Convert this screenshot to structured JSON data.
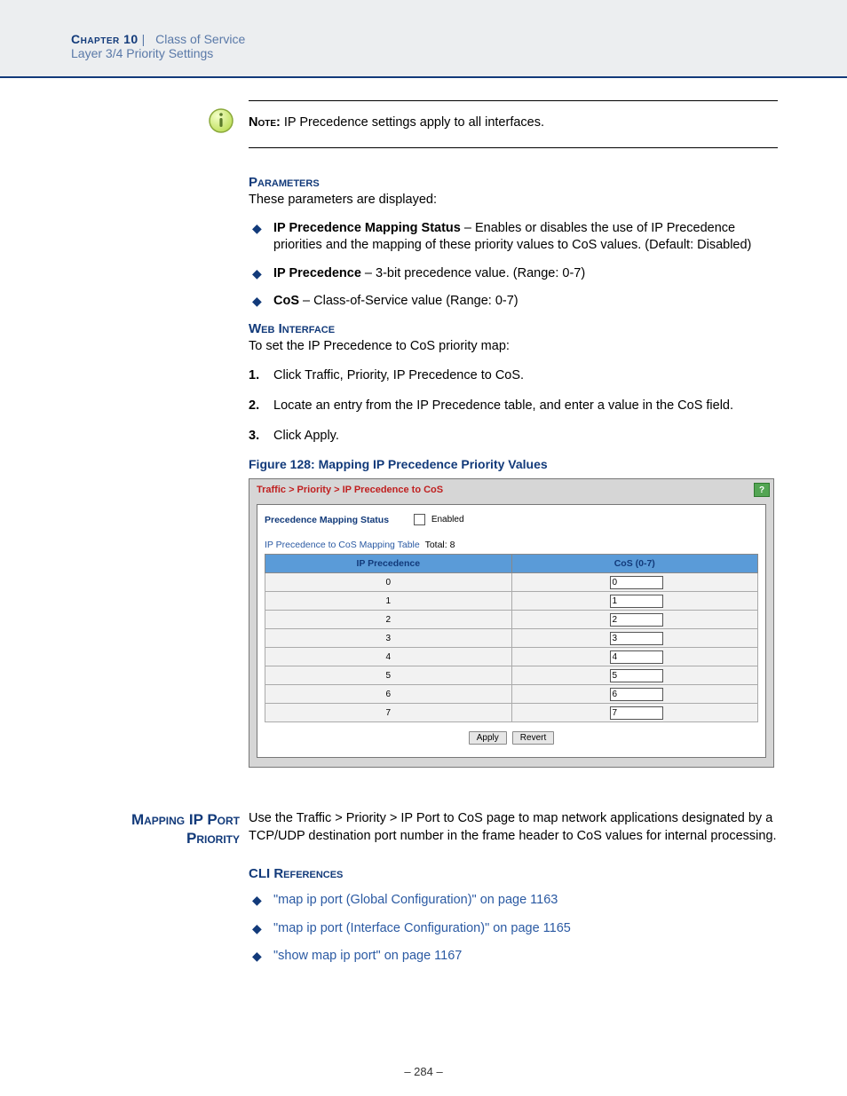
{
  "header": {
    "chapter": "Chapter 10",
    "chapter_title": "Class of Service",
    "subtitle": "Layer 3/4 Priority Settings"
  },
  "note": {
    "label": "Note:",
    "text": " IP Precedence settings apply to all interfaces."
  },
  "parameters": {
    "heading": "Parameters",
    "intro": "These parameters are displayed:",
    "items": [
      {
        "term": "IP Precedence Mapping Status",
        "desc": " – Enables or disables the use of IP Precedence priorities and the mapping of these priority values to CoS values. (Default: Disabled)"
      },
      {
        "term": "IP Precedence",
        "desc": " – 3-bit precedence value. (Range: 0-7)"
      },
      {
        "term": "CoS",
        "desc": " – Class-of-Service value (Range: 0-7)"
      }
    ]
  },
  "webinterface": {
    "heading": "Web Interface",
    "intro": "To set the IP Precedence to CoS priority map:",
    "steps": [
      "Click Traffic, Priority, IP Precedence to CoS.",
      "Locate an entry from the IP Precedence table, and enter a value in the CoS field.",
      "Click Apply."
    ]
  },
  "figure": {
    "caption": "Figure 128:  Mapping IP Precedence Priority Values",
    "breadcrumb": "Traffic > Priority > IP Precedence to CoS",
    "help": "?",
    "mapping_label": "Precedence Mapping Status",
    "enabled_label": "Enabled",
    "table_title_prefix": "IP Precedence to CoS Mapping Table",
    "table_total": "Total: 8",
    "col1": "IP Precedence",
    "col2": "CoS (0-7)",
    "rows": [
      {
        "prec": "0",
        "cos": "0"
      },
      {
        "prec": "1",
        "cos": "1"
      },
      {
        "prec": "2",
        "cos": "2"
      },
      {
        "prec": "3",
        "cos": "3"
      },
      {
        "prec": "4",
        "cos": "4"
      },
      {
        "prec": "5",
        "cos": "5"
      },
      {
        "prec": "6",
        "cos": "6"
      },
      {
        "prec": "7",
        "cos": "7"
      }
    ],
    "apply": "Apply",
    "revert": "Revert"
  },
  "section2": {
    "side_heading_l1": "Mapping IP Port",
    "side_heading_l2": "Priority",
    "intro": "Use the Traffic > Priority > IP Port to CoS page to map network applications designated by a TCP/UDP destination port number in the frame header to CoS values for internal processing.",
    "cli_heading": "CLI References",
    "links": [
      "\"map ip port (Global Configuration)\" on page 1163",
      "\"map ip port (Interface Configuration)\" on page 1165",
      "\"show map ip port\" on page 1167"
    ]
  },
  "page_number": "–  284  –"
}
